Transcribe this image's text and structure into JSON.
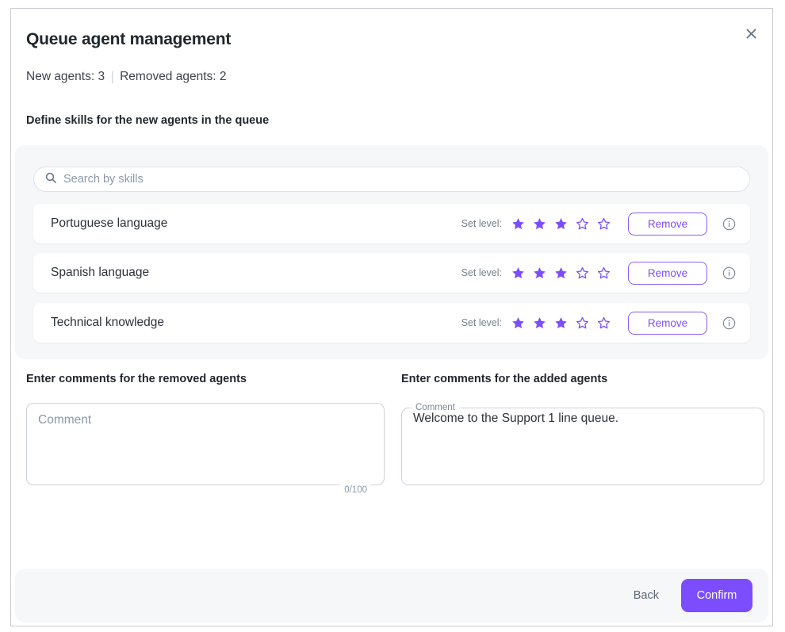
{
  "dialog": {
    "title": "Queue agent management",
    "close_icon": "close-icon",
    "new_agents_label": "New agents: 3",
    "removed_agents_label": "Removed agents: 2",
    "section_heading": "Define skills for the new agents in the queue"
  },
  "skills_panel": {
    "search": {
      "icon": "search-icon",
      "placeholder": "Search by skills",
      "value": ""
    },
    "set_level_label": "Set level:",
    "remove_label": "Remove",
    "info_icon": "info-circle-icon",
    "max_stars": 5,
    "rows": [
      {
        "name": "Portuguese language",
        "level": 3
      },
      {
        "name": "Spanish language",
        "level": 3
      },
      {
        "name": "Technical knowledge",
        "level": 3
      }
    ]
  },
  "comments": {
    "removed": {
      "heading": "Enter comments for the removed agents",
      "placeholder": "Comment",
      "value": "",
      "counter": "0/100"
    },
    "added": {
      "heading": "Enter comments for the added agents",
      "legend": "Comment",
      "value": "Welcome to the Support 1 line queue."
    }
  },
  "footer": {
    "back_label": "Back",
    "confirm_label": "Confirm"
  },
  "colors": {
    "accent": "#7c4dff",
    "star_filled": "#7c4dff",
    "panel_bg": "#f6f7f9",
    "text": "#22272e",
    "muted": "#76818f"
  }
}
